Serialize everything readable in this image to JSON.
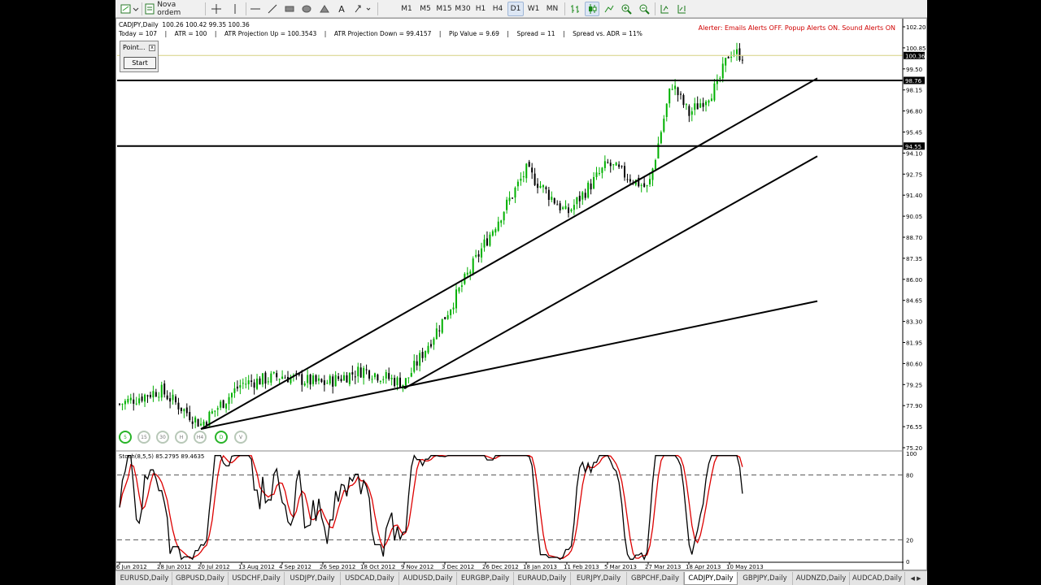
{
  "toolbar": {
    "new_order_label": "Nova ordem",
    "timeframes": [
      "M1",
      "M5",
      "M15",
      "M30",
      "H1",
      "H4",
      "D1",
      "W1",
      "MN"
    ],
    "selected_timeframe": "D1"
  },
  "chart": {
    "symbol_line": "CADJPY,Daily  100.26 100.42 99.35 100.36",
    "info_line": "Today = 107    |    ATR = 100    |    ATR Projection Up = 100.3543    |    ATR Projection Down = 99.4157    |    Pip Value = 9.69    |    Spread = 11    |    Spread vs. ADR = 11%",
    "alert_text": "Alerter:  Emails Alerts OFF.  Popup Alerts ON.  Sound Alerts ON",
    "point_panel_title": "Point...",
    "point_close": "x",
    "start_label": "Start",
    "tf_buttons": [
      "5",
      "15",
      "30",
      "H",
      "H4",
      "D",
      "V"
    ],
    "tf_active": [
      "5",
      "D"
    ],
    "price_labels": [
      "102.20",
      "100.85",
      "99.50",
      "98.15",
      "96.80",
      "95.45",
      "94.10",
      "92.75",
      "91.40",
      "90.05",
      "88.70",
      "87.35",
      "86.00",
      "84.65",
      "83.30",
      "81.95",
      "80.60",
      "79.25",
      "77.90",
      "76.55",
      "75.20"
    ],
    "bid_label": "100.36",
    "hline_labels": [
      "98.76",
      "94.55"
    ],
    "indicator_label": "Stoch(8,5,5) 85.2795 89.4635",
    "indicator_scale": [
      "100",
      "80",
      "20",
      "0"
    ],
    "date_labels": [
      "6 Jun 2012",
      "28 Jun 2012",
      "20 Jul 2012",
      "13 Aug 2012",
      "4 Sep 2012",
      "26 Sep 2012",
      "18 Oct 2012",
      "9 Nov 2012",
      "3 Dec 2012",
      "26 Dec 2012",
      "18 Jan 2013",
      "11 Feb 2013",
      "5 Mar 2013",
      "27 Mar 2013",
      "18 Apr 2013",
      "10 May 2013"
    ]
  },
  "tabs": [
    "EURUSD,Daily",
    "GBPUSD,Daily",
    "USDCHF,Daily",
    "USDJPY,Daily",
    "USDCAD,Daily",
    "AUDUSD,Daily",
    "EURGBP,Daily",
    "EURAUD,Daily",
    "EURJPY,Daily",
    "GBPCHF,Daily",
    "CADJPY,Daily",
    "GBPJPY,Daily",
    "AUDNZD,Daily",
    "AUDCAD,Daily"
  ],
  "active_tab": "CADJPY,Daily",
  "colors": {
    "bull": "#00b000",
    "bear": "#000000",
    "stoch_main": "#000000",
    "stoch_signal": "#dd0000",
    "alert": "#d00000"
  },
  "chart_data": {
    "type": "candlestick",
    "symbol": "CADJPY",
    "timeframe": "Daily",
    "y_range": [
      75.2,
      102.2
    ],
    "price_path": [
      [
        "6 Jun 2012",
        78.0
      ],
      [
        "28 Jun 2012",
        78.9
      ],
      [
        "20 Jul 2012",
        76.7
      ],
      [
        "13 Aug 2012",
        79.3
      ],
      [
        "4 Sep 2012",
        79.8
      ],
      [
        "26 Sep 2012",
        79.3
      ],
      [
        "18 Oct 2012",
        80.2
      ],
      [
        "9 Nov 2012",
        79.3
      ],
      [
        "3 Dec 2012",
        83.6
      ],
      [
        "26 Dec 2012",
        88.4
      ],
      [
        "18 Jan 2013",
        93.0
      ],
      [
        "11 Feb 2013",
        90.2
      ],
      [
        "5 Mar 2013",
        93.4
      ],
      [
        "27 Mar 2013",
        91.8
      ],
      [
        "8 Apr 2013",
        98.6
      ],
      [
        "18 Apr 2013",
        96.6
      ],
      [
        "3 May 2013",
        98.4
      ],
      [
        "10 May 2013",
        100.6
      ],
      [
        "17 May 2013",
        100.36
      ]
    ],
    "horizontal_lines": [
      98.76,
      94.55
    ],
    "trendlines": [
      {
        "from": [
          "20 Jul 2012",
          76.4
        ],
        "to": [
          "23 May 2013",
          98.9
        ]
      },
      {
        "from": [
          "9 Nov 2012",
          79.0
        ],
        "to": [
          "23 May 2013",
          93.9
        ]
      },
      {
        "from": [
          "20 Jul 2012",
          76.4
        ],
        "to": [
          "23 May 2013",
          84.6
        ]
      }
    ],
    "indicator": {
      "name": "Stoch(8,5,5)",
      "main": 85.2795,
      "signal": 89.4635,
      "levels": [
        80,
        20
      ],
      "range": [
        0,
        100
      ]
    }
  }
}
